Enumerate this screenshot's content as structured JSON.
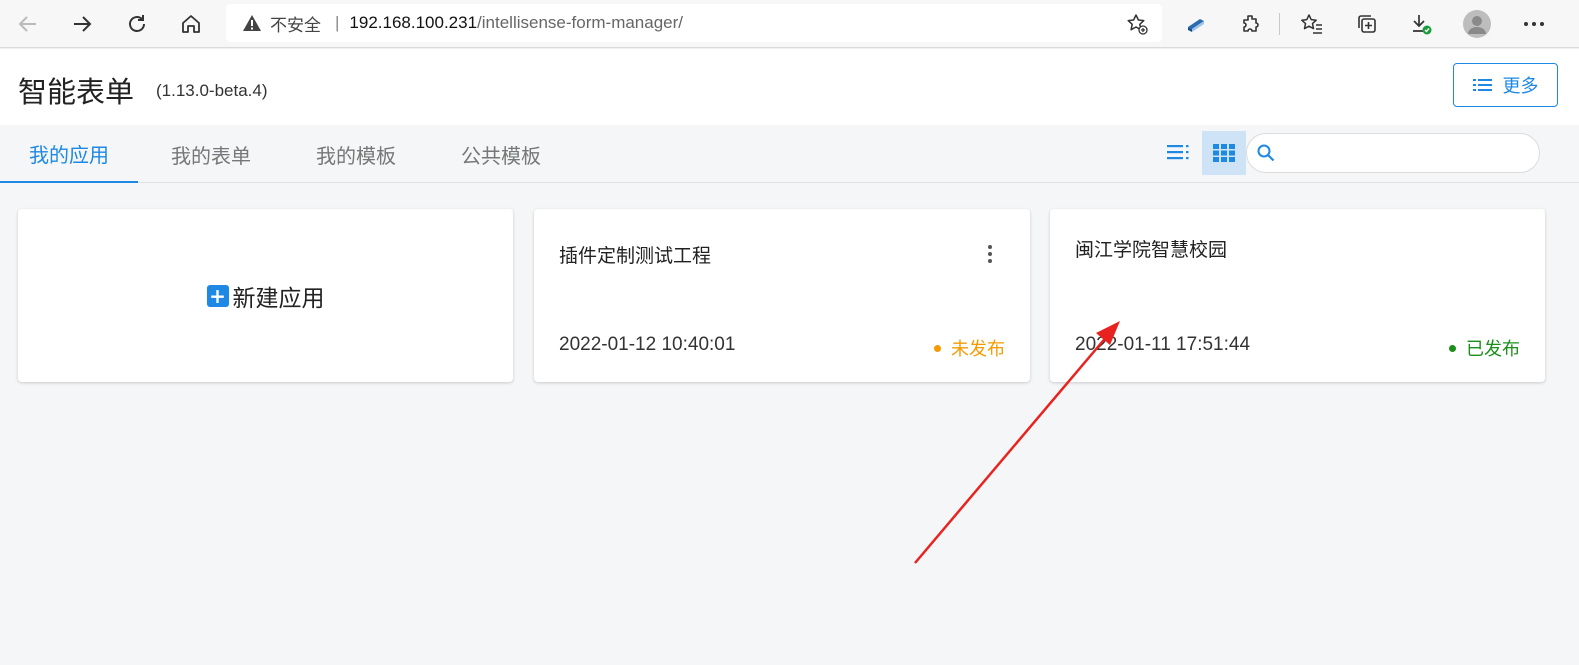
{
  "browser": {
    "security_label": "不安全",
    "url_host": "192.168.100.231",
    "url_path": "/intellisense-form-manager/"
  },
  "app": {
    "title": "智能表单",
    "version": "(1.13.0-beta.4)",
    "more_label": "更多"
  },
  "tabs": [
    {
      "label": "我的应用",
      "active": true
    },
    {
      "label": "我的表单",
      "active": false
    },
    {
      "label": "我的模板",
      "active": false
    },
    {
      "label": "公共模板",
      "active": false
    }
  ],
  "search": {
    "placeholder": ""
  },
  "new_app": {
    "label": "新建应用"
  },
  "apps": [
    {
      "title": "插件定制测试工程",
      "date": "2022-01-12 10:40:01",
      "status": "未发布",
      "status_color": "#f59a00"
    },
    {
      "title": "闽江学院智慧校园",
      "date": "2022-01-11 17:51:44",
      "status": "已发布",
      "status_color": "#1a8f1a"
    }
  ],
  "colors": {
    "accent": "#1e88e5",
    "annotation": "#e8231f"
  }
}
